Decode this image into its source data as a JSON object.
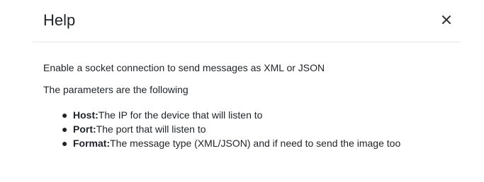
{
  "dialog": {
    "title": "Help",
    "close_icon": "close-icon"
  },
  "body": {
    "intro": "Enable a socket connection to send messages as XML or JSON",
    "params_heading": "The parameters are the following",
    "params": [
      {
        "name": "Host:",
        "description": "The IP for the device that will listen to"
      },
      {
        "name": "Port:",
        "description": "The port that will listen to"
      },
      {
        "name": "Format:",
        "description": "The message type (XML/JSON) and if need to send the image too"
      }
    ]
  }
}
